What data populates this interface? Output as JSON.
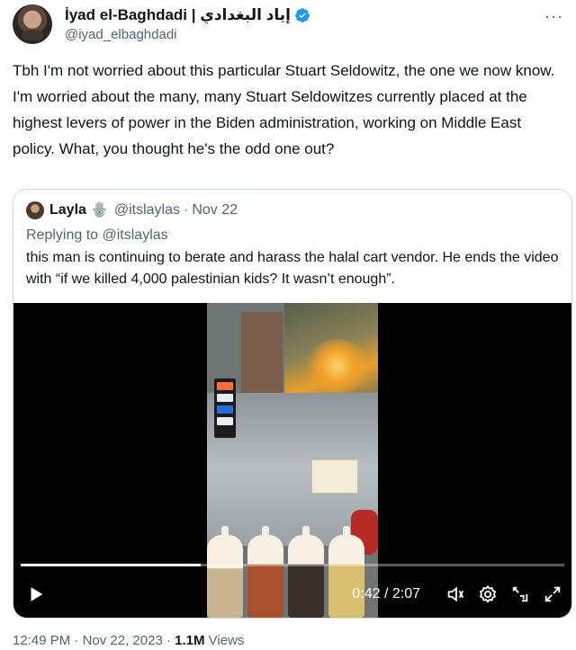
{
  "author": {
    "display_name": "İyad el-Baghdadi | إياد البغدادي",
    "handle": "@iyad_elbaghdadi",
    "verified_icon": "verified-badge-icon"
  },
  "more_label": "···",
  "tweet": {
    "text": "Tbh I'm not worried about this particular Stuart Seldowitz, the one we now know. I'm worried about the many, many Stuart Seldowitzes currently placed at the highest levers of power in the Biden administration, working on Middle East policy. What, you thought he's the odd one out?"
  },
  "quoted": {
    "name": "Layla",
    "emoji": "🪬",
    "handle": "@itslaylas",
    "separator": "·",
    "date": "Nov 22",
    "replying_to": "Replying to @itslaylas",
    "text": "this man is continuing to berate and harass the halal cart vendor. He ends the video with “if we killed 4,000 palestinian kids? It wasn’t enough”."
  },
  "video": {
    "time": "0:42 / 2:07",
    "progress_fraction": 0.331,
    "controls": [
      "play-icon",
      "volume-icon",
      "settings-icon",
      "pip-icon",
      "fullscreen-icon"
    ]
  },
  "footer": {
    "time": "12:49 PM",
    "separator": "·",
    "date": "Nov 22, 2023",
    "views_count": "1.1M",
    "views_label": "Views"
  },
  "colors": {
    "text": "#0f1419",
    "secondary": "#536471",
    "verified": "#1d9bf0",
    "border": "#cfd9de"
  }
}
